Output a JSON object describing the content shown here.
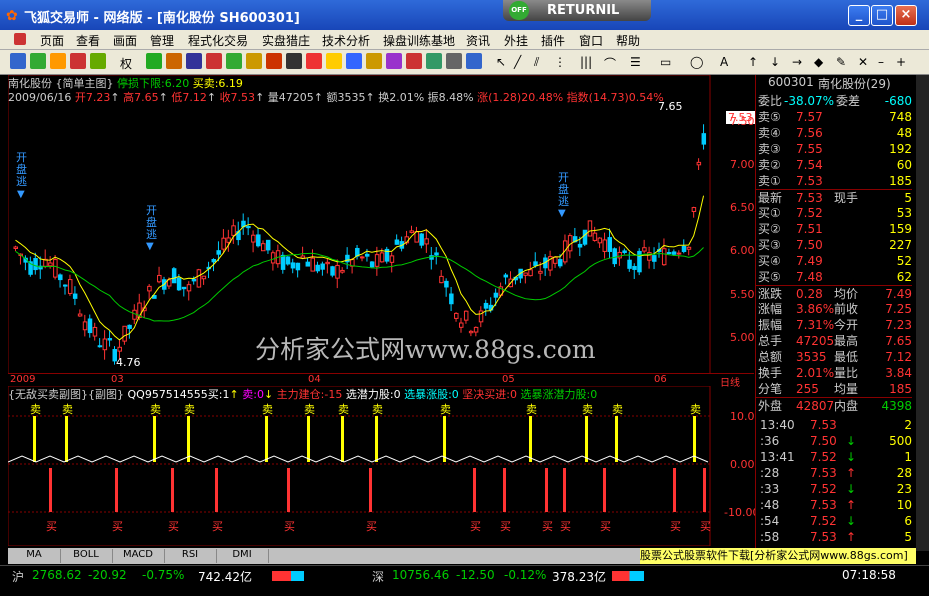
{
  "window": {
    "title": "飞狐交易师 - 网络版 - [南化股份 SH600301]",
    "returnil": "RETURNIL",
    "returnil_badge": "OFF"
  },
  "menu": [
    "页面",
    "查看",
    "画面",
    "管理",
    "程式化交易",
    "实盘猎庄",
    "技术分析",
    "操盘训练基地",
    "资讯",
    "外挂",
    "插件",
    "窗口",
    "帮助"
  ],
  "toolbar": {
    "quan_label": "权"
  },
  "main_chart": {
    "name": "南化股份",
    "template": "{简单主图}",
    "stop_label": "停损下限:6.20",
    "sell_label": "买卖:6.19",
    "date": "2009/06/16",
    "open": "开7.23",
    "high": "高7.65",
    "low": "低7.12",
    "close": "收7.53",
    "volume": "量47205",
    "amount": "额3535",
    "turnover": "换2.01%",
    "amplitude": "振8.48%",
    "change": "涨(1.28)20.48%",
    "index": "指数(14.73)0.54%",
    "price_labels": [
      "7.65",
      "7.53",
      "4.76"
    ],
    "y_ticks": [
      "7.50",
      "7.00",
      "6.50",
      "6.00",
      "5.50",
      "5.00"
    ],
    "x_labels": [
      "2009",
      "03",
      "04",
      "05",
      "06"
    ],
    "x_unit": "日线",
    "markers": [
      {
        "text": "开盘逃"
      },
      {
        "text": "开盘逃"
      },
      {
        "text": "开盘逃"
      }
    ]
  },
  "sub_chart": {
    "title": "{无敌买卖副图}{副图}",
    "qq": "QQ957514555买:1",
    "sell": "卖:0",
    "main_build": "主力建仓:-15",
    "latent": "选潜力股:0",
    "surge": "选暴涨股:0",
    "firm_buy": "坚决买进:0",
    "surge_latent": "选暴涨潜力股:0",
    "y_ticks": [
      "10.00",
      "0.00",
      "-10.00"
    ],
    "sell_label": "卖",
    "buy_label": "买"
  },
  "quote": {
    "code": "600301",
    "name": "南化股份(29)",
    "weibi_label": "委比",
    "weibi": "-38.07%",
    "weicha_label": "委差",
    "weicha": "-680",
    "asks": [
      {
        "label": "卖⑤",
        "price": "7.57",
        "vol": "748"
      },
      {
        "label": "卖④",
        "price": "7.56",
        "vol": "48"
      },
      {
        "label": "卖③",
        "price": "7.55",
        "vol": "192"
      },
      {
        "label": "卖②",
        "price": "7.54",
        "vol": "60"
      },
      {
        "label": "卖①",
        "price": "7.53",
        "vol": "185"
      }
    ],
    "last_label": "最新",
    "last": "7.53",
    "hand_label": "现手",
    "hand": "5",
    "bids": [
      {
        "label": "买①",
        "price": "7.52",
        "vol": "53"
      },
      {
        "label": "买②",
        "price": "7.51",
        "vol": "159"
      },
      {
        "label": "买③",
        "price": "7.50",
        "vol": "227"
      },
      {
        "label": "买④",
        "price": "7.49",
        "vol": "52"
      },
      {
        "label": "买⑤",
        "price": "7.48",
        "vol": "62"
      }
    ],
    "stats": [
      {
        "l": "涨跌",
        "v": "0.28",
        "l2": "均价",
        "v2": "7.49"
      },
      {
        "l": "涨幅",
        "v": "3.86%",
        "l2": "前收",
        "v2": "7.25"
      },
      {
        "l": "振幅",
        "v": "7.31%",
        "l2": "今开",
        "v2": "7.23"
      },
      {
        "l": "总手",
        "v": "47205",
        "l2": "最高",
        "v2": "7.65"
      },
      {
        "l": "总额",
        "v": "3535",
        "l2": "最低",
        "v2": "7.12"
      },
      {
        "l": "换手",
        "v": "2.01%",
        "l2": "量比",
        "v2": "3.84"
      },
      {
        "l": "分笔",
        "v": "255",
        "l2": "均量",
        "v2": "185"
      }
    ],
    "outer_label": "外盘",
    "outer": "42807",
    "inner_label": "内盘",
    "inner": "4398",
    "ticks": [
      {
        "t": "13:40",
        "p": "7.53",
        "a": "",
        "v": "2"
      },
      {
        "t": ":36",
        "p": "7.50",
        "a": "↓",
        "v": "500"
      },
      {
        "t": "13:41",
        "p": "7.52",
        "a": "↓",
        "v": "1"
      },
      {
        "t": ":28",
        "p": "7.53",
        "a": "↑",
        "v": "28"
      },
      {
        "t": ":33",
        "p": "7.52",
        "a": "↓",
        "v": "23"
      },
      {
        "t": ":48",
        "p": "7.53",
        "a": "↑",
        "v": "10"
      },
      {
        "t": ":54",
        "p": "7.52",
        "a": "↓",
        "v": "6"
      },
      {
        "t": ":58",
        "p": "7.53",
        "a": "↑",
        "v": "5"
      }
    ]
  },
  "bottom_tabs": [
    "MA",
    "BOLL",
    "MACD",
    "RSI",
    "DMI"
  ],
  "ad": "股票公式股票软件下载[分析家公式网www.88gs.com]",
  "watermark": "分析家公式网www.88gs.com",
  "status": {
    "sh_label": "沪",
    "sh_index": "2768.62",
    "sh_change": "-20.92",
    "sh_pct": "-0.75%",
    "sh_amount": "742.42亿",
    "sz_label": "深",
    "sz_index": "10756.46",
    "sz_change": "-12.50",
    "sz_pct": "-0.12%",
    "sz_amount": "378.23亿",
    "time": "07:18:58"
  },
  "colors": {
    "up": "#ff3333",
    "down": "#00cc00",
    "ma": "#ffff00"
  }
}
